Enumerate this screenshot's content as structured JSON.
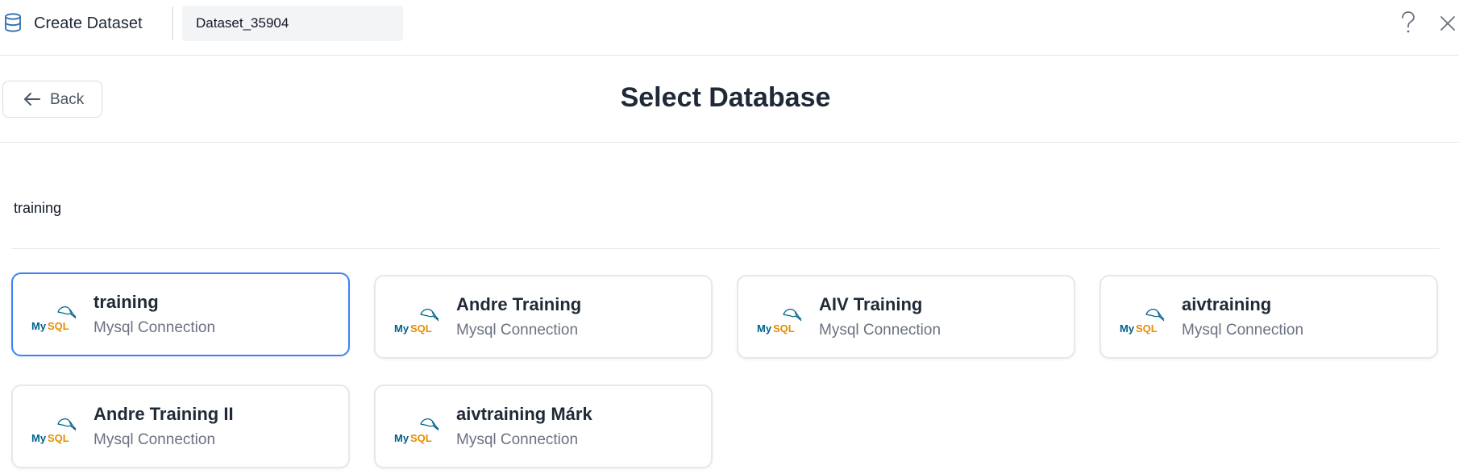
{
  "topbar": {
    "app_title": "Create Dataset",
    "dataset_name": "Dataset_35904",
    "icons": {
      "app": "database-icon",
      "help": "help-icon",
      "close": "close-icon"
    }
  },
  "header": {
    "back_label": "Back",
    "page_title": "Select Database"
  },
  "search": {
    "value": "training"
  },
  "databases": [
    {
      "name": "training",
      "type": "Mysql Connection",
      "logo": "mysql-logo",
      "selected": true
    },
    {
      "name": "Andre Training",
      "type": "Mysql Connection",
      "logo": "mysql-logo",
      "selected": false
    },
    {
      "name": "AIV Training",
      "type": "Mysql Connection",
      "logo": "mysql-logo",
      "selected": false
    },
    {
      "name": "aivtraining",
      "type": "Mysql Connection",
      "logo": "mysql-logo",
      "selected": false
    },
    {
      "name": "Andre Training II",
      "type": "Mysql Connection",
      "logo": "mysql-logo",
      "selected": false
    },
    {
      "name": "aivtraining Márk",
      "type": "Mysql Connection",
      "logo": "mysql-logo",
      "selected": false
    }
  ],
  "colors": {
    "accent": "#3b82f6",
    "mysql_blue": "#00618a",
    "mysql_orange": "#e48e00"
  }
}
